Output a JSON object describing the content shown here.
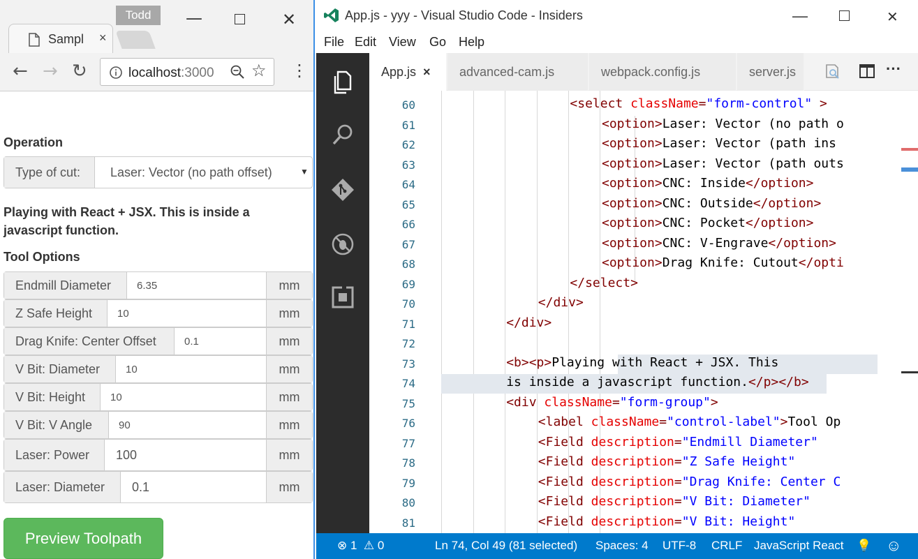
{
  "browser": {
    "tab_title": "Sampl",
    "tab_close": "×",
    "user": "Todd",
    "url_host": "localhost",
    "url_port": ":3000"
  },
  "page": {
    "operation_heading": "Operation",
    "type_of_cut_label": "Type of cut:",
    "type_of_cut_value": "Laser: Vector (no path offset)",
    "paragraph": "Playing with React + JSX. This is inside a javascript function.",
    "tool_options_heading": "Tool Options",
    "fields": [
      {
        "label": "Endmill Diameter",
        "value": "6.35",
        "unit": "mm"
      },
      {
        "label": "Z Safe Height",
        "value": "10",
        "unit": "mm"
      },
      {
        "label": "Drag Knife: Center Offset",
        "value": "0.1",
        "unit": "mm"
      },
      {
        "label": "V Bit: Diameter",
        "value": "10",
        "unit": "mm"
      },
      {
        "label": "V Bit: Height",
        "value": "10",
        "unit": "mm"
      },
      {
        "label": "V Bit: V Angle",
        "value": "90",
        "unit": "mm"
      },
      {
        "label": "Laser: Power",
        "value": "100",
        "unit": "mm"
      },
      {
        "label": "Laser: Diameter",
        "value": "0.1",
        "unit": "mm"
      }
    ],
    "preview_button": "Preview Toolpath"
  },
  "vscode": {
    "title": "App.js - yyy - Visual Studio Code - Insiders",
    "menu": [
      "File",
      "Edit",
      "View",
      "Go",
      "Help"
    ],
    "tabs": [
      "App.js",
      "advanced-cam.js",
      "webpack.config.js",
      "server.js"
    ],
    "tab_close": "×",
    "more": "···",
    "lines": [
      {
        "n": "60",
        "indent": 5,
        "code": "<select className=\"form-control\" >"
      },
      {
        "n": "61",
        "indent": 6,
        "code": "<option>Laser: Vector (no path o"
      },
      {
        "n": "62",
        "indent": 6,
        "code": "<option>Laser: Vector (path ins"
      },
      {
        "n": "63",
        "indent": 6,
        "code": "<option>Laser: Vector (path outs"
      },
      {
        "n": "64",
        "indent": 6,
        "code": "<option>CNC: Inside</option>"
      },
      {
        "n": "65",
        "indent": 6,
        "code": "<option>CNC: Outside</option>"
      },
      {
        "n": "66",
        "indent": 6,
        "code": "<option>CNC: Pocket</option>"
      },
      {
        "n": "67",
        "indent": 6,
        "code": "<option>CNC: V-Engrave</option>"
      },
      {
        "n": "68",
        "indent": 6,
        "code": "<option>Drag Knife: Cutout</opti"
      },
      {
        "n": "69",
        "indent": 5,
        "code": "</select>"
      },
      {
        "n": "70",
        "indent": 4,
        "code": "</div>"
      },
      {
        "n": "71",
        "indent": 3,
        "code": "</div>"
      },
      {
        "n": "72",
        "indent": 3,
        "code": ""
      },
      {
        "n": "73",
        "indent": 3,
        "code": "<b><p>Playing with React + JSX. This"
      },
      {
        "n": "74",
        "indent": 3,
        "code": "is inside a javascript function.</p></b>"
      },
      {
        "n": "75",
        "indent": 3,
        "code": "<div className=\"form-group\">"
      },
      {
        "n": "76",
        "indent": 4,
        "code": "<label className=\"control-label\">Tool Op"
      },
      {
        "n": "77",
        "indent": 4,
        "code": "<Field description=\"Endmill Diameter\""
      },
      {
        "n": "78",
        "indent": 4,
        "code": "<Field description=\"Z Safe Height\""
      },
      {
        "n": "79",
        "indent": 4,
        "code": "<Field description=\"Drag Knife: Center C"
      },
      {
        "n": "80",
        "indent": 4,
        "code": "<Field description=\"V Bit: Diameter\""
      },
      {
        "n": "81",
        "indent": 4,
        "code": "<Field description=\"V Bit: Height\""
      }
    ],
    "status": {
      "errors": "1",
      "warnings": "0",
      "position": "Ln 74, Col 49 (81 selected)",
      "spaces": "Spaces: 4",
      "encoding": "UTF-8",
      "eol": "CRLF",
      "language": "JavaScript React"
    }
  },
  "colors": {
    "vscode_blue": "#007acc",
    "activity_bar": "#2c2c2c",
    "button_green": "#5cb85c",
    "line_number": "#2b6b86"
  }
}
